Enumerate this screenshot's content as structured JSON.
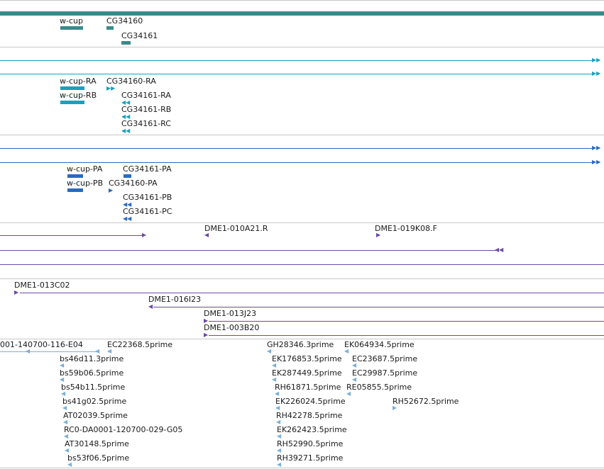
{
  "colors": {
    "gene": "#3a8a8a",
    "transcript": "#1aa0c0",
    "protein": "#2a6ac0",
    "bac": "#6a4aa8",
    "est": "#7ab0d8"
  },
  "gene_track": {
    "labels": [
      "w-cup",
      "CG34160",
      "CG34161"
    ]
  },
  "transcript_track": {
    "labels": [
      "w-cup-RA",
      "CG34160-RA",
      "w-cup-RB",
      "CG34161-RA",
      "CG34161-RB",
      "CG34161-RC"
    ]
  },
  "protein_track": {
    "labels": [
      "w-cup-PA",
      "CG34161-PA",
      "w-cup-PB",
      "CG34160-PA",
      "CG34161-PB",
      "CG34161-PC"
    ]
  },
  "bac_track": {
    "labels": [
      "DME1-010A21.R",
      "DME1-019K08.F",
      "DME1-013C02",
      "DME1-016I23",
      "DME1-013J23",
      "DME1-003B20"
    ]
  },
  "est_track": {
    "col1": [
      "001-140700-116-E04",
      "bs46d11.3prime",
      "bs59b06.5prime",
      "bs54b11.5prime",
      "bs41g02.5prime",
      "AT02039.5prime",
      "RC0-DA0001-120700-029-G05",
      "AT30148.5prime",
      "bs53f06.5prime"
    ],
    "col2": [
      "EC22368.5prime"
    ],
    "col3": [
      "GH28346.3prime",
      "EK176853.5prime",
      "EK287449.5prime",
      "RH61871.5prime",
      "EK226024.5prime",
      "RH42278.5prime",
      "EK262423.5prime",
      "RH52990.5prime",
      "RH39271.5prime"
    ],
    "col4": [
      "EK064934.5prime",
      "EC23687.5prime",
      "EC29987.5prime",
      "RE05855.5prime",
      "RH52672.5prime"
    ]
  }
}
